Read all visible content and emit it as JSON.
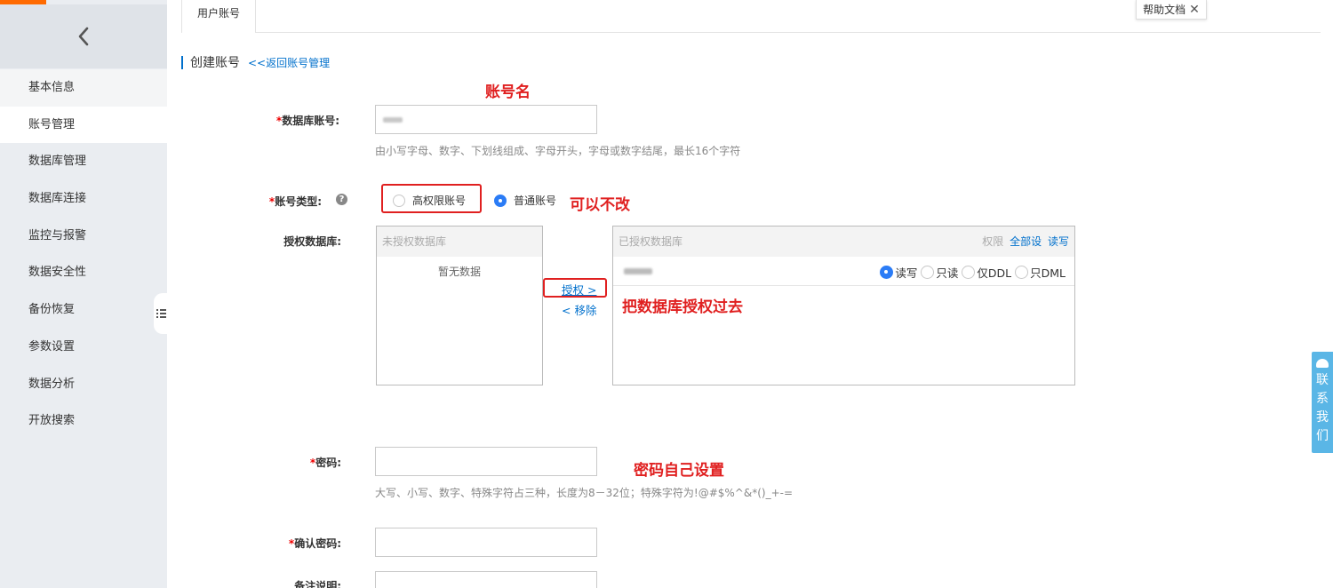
{
  "sidebar": {
    "back_icon": "chevron-left-icon",
    "items": [
      {
        "label": "基本信息"
      },
      {
        "label": "账号管理"
      },
      {
        "label": "数据库管理"
      },
      {
        "label": "数据库连接"
      },
      {
        "label": "监控与报警"
      },
      {
        "label": "数据安全性"
      },
      {
        "label": "备份恢复"
      },
      {
        "label": "参数设置"
      },
      {
        "label": "数据分析"
      },
      {
        "label": "开放搜索"
      }
    ],
    "active_item": "账号管理"
  },
  "tabs": [
    {
      "label": "用户账号"
    }
  ],
  "help": {
    "label": "帮助文档",
    "close": "✕"
  },
  "section": {
    "title": "创建账号",
    "back_link": "<<返回账号管理"
  },
  "form": {
    "account": {
      "required_mark": "*",
      "label": "数据库账号:",
      "hint": "由小写字母、数字、下划线组成、字母开头，字母或数字结尾，最长16个字符"
    },
    "account_type": {
      "required_mark": "*",
      "label": "账号类型:",
      "help_icon": "question-icon",
      "options": [
        {
          "label": "高权限账号",
          "selected": false
        },
        {
          "label": "普通账号",
          "selected": true
        }
      ]
    },
    "authorize": {
      "label": "授权数据库:",
      "unauthorized_header": "未授权数据库",
      "empty_text": "暂无数据",
      "grant": "授权 >",
      "remove": "< 移除",
      "authorized_header": "已授权数据库",
      "perm_label": "权限",
      "set_all": "全部设",
      "set_all_value": "读写",
      "permissions": [
        {
          "label": "读写",
          "selected": true
        },
        {
          "label": "只读",
          "selected": false
        },
        {
          "label": "仅DDL",
          "selected": false
        },
        {
          "label": "只DML",
          "selected": false
        }
      ]
    },
    "password": {
      "required_mark": "*",
      "label": "密码:",
      "hint": "大写、小写、数字、特殊字符占三种，长度为8－32位；特殊字符为!@#$%^&*()_+-="
    },
    "confirm_password": {
      "required_mark": "*",
      "label": "确认密码:"
    },
    "remark": {
      "label": "备注说明:"
    }
  },
  "annotations": {
    "account_name": "账号名",
    "type_note": "可以不改",
    "grant_note": "把数据库授权过去",
    "password_note": "密码自己设置",
    "color": "#e02020"
  },
  "contact": {
    "chars": [
      "联",
      "系",
      "我",
      "们"
    ]
  },
  "colors": {
    "accent": "#0070cc",
    "brand": "#ff6a00",
    "radio": "#2b7cf6",
    "contact": "#5ab6e6"
  }
}
